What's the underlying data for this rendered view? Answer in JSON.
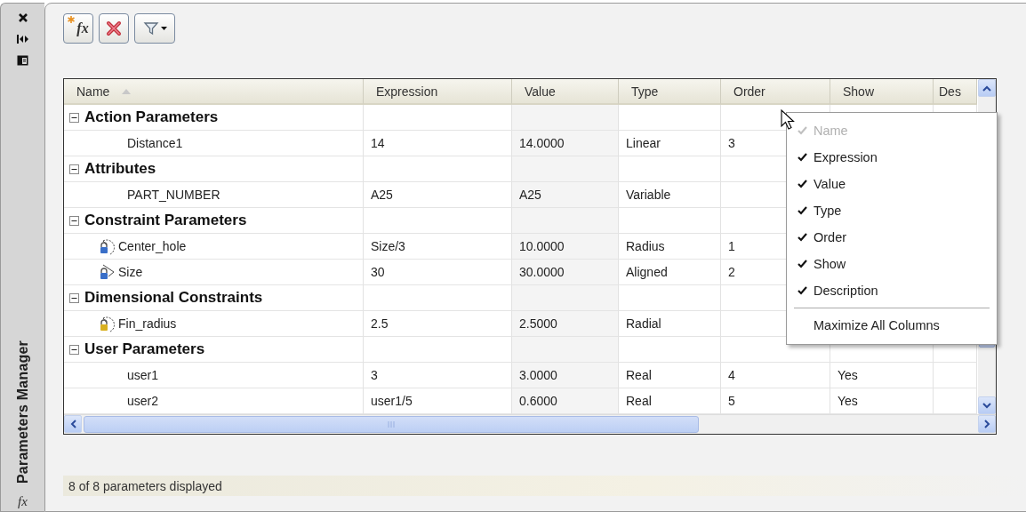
{
  "sidebar": {
    "title": "Parameters Manager",
    "footer_glyph": "fx"
  },
  "toolbar": {
    "new_glyph": "fx"
  },
  "table": {
    "columns": [
      {
        "label": "Name",
        "sorted": true
      },
      {
        "label": "Expression",
        "sorted": false
      },
      {
        "label": "Value",
        "sorted": false
      },
      {
        "label": "Type",
        "sorted": false
      },
      {
        "label": "Order",
        "sorted": false
      },
      {
        "label": "Show",
        "sorted": false
      },
      {
        "label": "Des",
        "sorted": false
      }
    ],
    "rows": [
      {
        "kind": "group",
        "name": "Action Parameters",
        "expanded": true
      },
      {
        "kind": "param",
        "name": "Distance1",
        "expression": "14",
        "value": "14.0000",
        "type": "Linear",
        "order": "3",
        "show": ""
      },
      {
        "kind": "group",
        "name": "Attributes",
        "expanded": true
      },
      {
        "kind": "param",
        "name": "PART_NUMBER",
        "expression": "A25",
        "value": "A25",
        "type": "Variable",
        "order": "",
        "show": ""
      },
      {
        "kind": "group",
        "name": "Constraint Parameters",
        "expanded": true
      },
      {
        "kind": "radius_constraint",
        "color": "#3a6fc8",
        "name": "Center_hole",
        "expression": "Size/3",
        "value": "10.0000",
        "type": "Radius",
        "order": "1",
        "show": ""
      },
      {
        "kind": "aligned_constraint",
        "color": "#3a6fc8",
        "name": "Size",
        "expression": "30",
        "value": "30.0000",
        "type": "Aligned",
        "order": "2",
        "show": ""
      },
      {
        "kind": "group",
        "name": "Dimensional Constraints",
        "expanded": true
      },
      {
        "kind": "radius_constraint",
        "color": "#d8b020",
        "name": "Fin_radius",
        "expression": "2.5",
        "value": "2.5000",
        "type": "Radial",
        "order": "",
        "show": ""
      },
      {
        "kind": "group",
        "name": "User Parameters",
        "expanded": true
      },
      {
        "kind": "param",
        "name": "user1",
        "expression": "3",
        "value": "3.0000",
        "type": "Real",
        "order": "4",
        "show": "Yes"
      },
      {
        "kind": "param",
        "name": "user2",
        "expression": "user1/5",
        "value": "0.6000",
        "type": "Real",
        "order": "5",
        "show": "Yes"
      }
    ]
  },
  "column_menu": {
    "items": [
      {
        "label": "Name",
        "checked": true,
        "disabled": true
      },
      {
        "label": "Expression",
        "checked": true,
        "disabled": false
      },
      {
        "label": "Value",
        "checked": true,
        "disabled": false
      },
      {
        "label": "Type",
        "checked": true,
        "disabled": false
      },
      {
        "label": "Order",
        "checked": true,
        "disabled": false
      },
      {
        "label": "Show",
        "checked": true,
        "disabled": false
      },
      {
        "label": "Description",
        "checked": true,
        "disabled": false
      }
    ],
    "action": "Maximize All Columns"
  },
  "status_bar": "8 of 8 parameters displayed"
}
